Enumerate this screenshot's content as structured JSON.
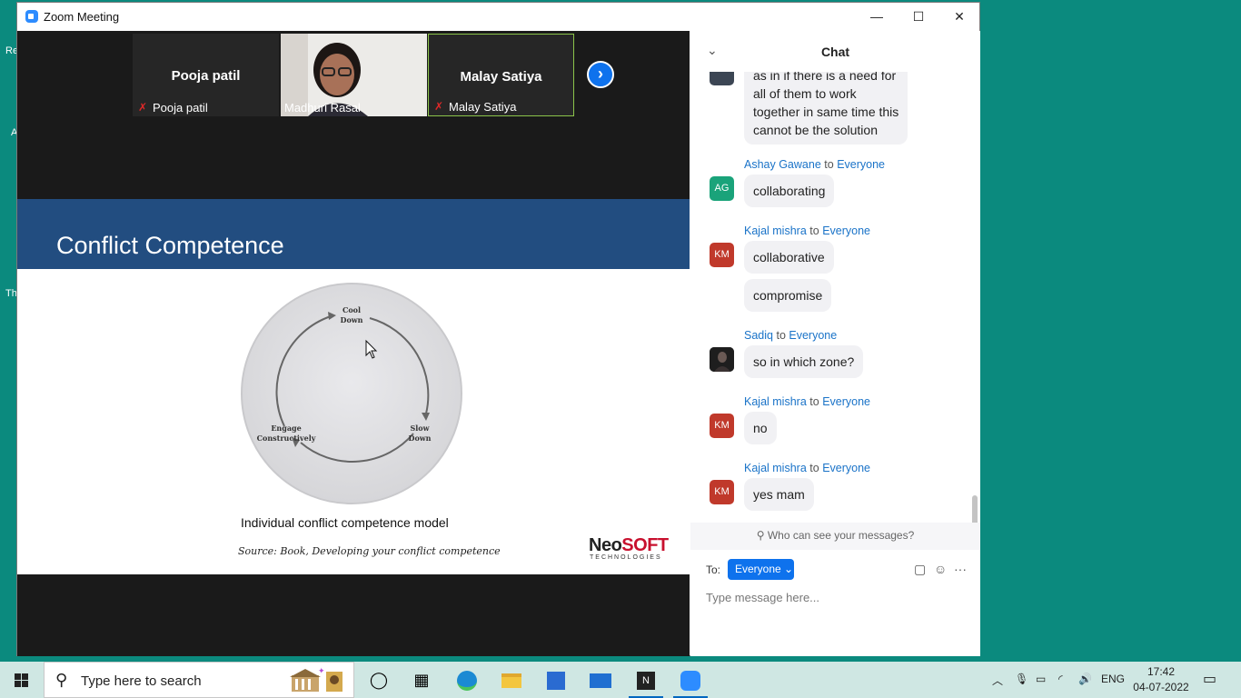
{
  "desktop": {
    "labels": [
      "Re",
      "A",
      "Th"
    ]
  },
  "window": {
    "title": "Zoom Meeting",
    "minimize": "—",
    "maximize": "☐",
    "close": "✕"
  },
  "participants": [
    {
      "big_name": "Pooja patil",
      "label": "Pooja patil",
      "muted": true
    },
    {
      "big_name": "",
      "label": "Madhuri Rasal",
      "muted": false
    },
    {
      "big_name": "Malay Satiya",
      "label": "Malay Satiya",
      "muted": true
    }
  ],
  "slide": {
    "title": "Conflict Competence",
    "diagram": {
      "cool": [
        "Cool",
        "Down"
      ],
      "slow": [
        "Slow",
        "Down"
      ],
      "engage": [
        "Engage",
        "Constructively"
      ]
    },
    "caption": "Individual conflict competence model",
    "source": "Source: Book, Developing your conflict competence",
    "logo_neo": "Neo",
    "logo_soft": "SOFT",
    "logo_sub": "TECHNOLOGIES"
  },
  "chat": {
    "title": "Chat",
    "first_message": [
      "as in if there is a need for",
      "all of them to work",
      "together in same time this",
      "cannot be the solution"
    ],
    "messages": [
      {
        "sender": "Ashay Gawane",
        "initials": "AG",
        "avatar_color": "#1aa37a",
        "to": "to",
        "target": "Everyone",
        "bubbles": [
          "collaborating"
        ]
      },
      {
        "sender": "Kajal mishra",
        "initials": "KM",
        "avatar_color": "#c0392b",
        "to": "to",
        "target": "Everyone",
        "bubbles": [
          "collaborative",
          "compromise"
        ]
      },
      {
        "sender": "Sadiq",
        "initials": "",
        "avatar_color": "#2a2a2a",
        "to": "to",
        "target": "Everyone",
        "bubbles": [
          "so in which zone?"
        ]
      },
      {
        "sender": "Kajal mishra",
        "initials": "KM",
        "avatar_color": "#c0392b",
        "to": "to",
        "target": "Everyone",
        "bubbles": [
          "no"
        ]
      },
      {
        "sender": "Kajal mishra",
        "initials": "KM",
        "avatar_color": "#c0392b",
        "to": "to",
        "target": "Everyone",
        "bubbles": [
          "yes mam"
        ]
      }
    ],
    "who_can_see": "Who can see your messages?",
    "to_label": "To:",
    "to_value": "Everyone",
    "input_placeholder": "Type message here..."
  },
  "taskbar": {
    "search_placeholder": "Type here to search",
    "apps": [
      "cortana-icon",
      "task-view-icon",
      "edge-icon",
      "file-explorer-icon",
      "store-icon",
      "mail-icon",
      "onenote-icon",
      "zoom-icon"
    ],
    "language": "ENG",
    "time": "17:42",
    "date": "04-07-2022"
  }
}
